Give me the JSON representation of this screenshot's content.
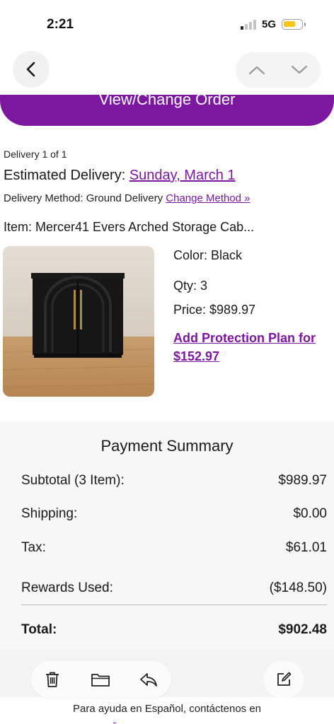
{
  "status": {
    "time": "2:21",
    "network": "5G"
  },
  "order_button": {
    "label": "View/Change Order"
  },
  "delivery": {
    "count": "Delivery 1 of 1",
    "estimated_label": "Estimated Delivery:",
    "estimated_date": "Sunday, March 1",
    "method_label": "Delivery Method: Ground Delivery",
    "change_method": "Change Method »"
  },
  "item": {
    "label": "Item:",
    "name": "Mercer41 Evers Arched Storage Cab...",
    "color_label": "Color:",
    "color": "Black",
    "qty_label": "Qty:",
    "qty": "3",
    "price_label": "Price:",
    "price": "$989.97",
    "protection_line1": "Add Protection Plan for",
    "protection_line2": "$152.97"
  },
  "payment": {
    "title": "Payment Summary",
    "subtotal_label": "Subtotal (3 Item):",
    "subtotal": "$989.97",
    "shipping_label": "Shipping:",
    "shipping": "$0.00",
    "tax_label": "Tax:",
    "tax": "$61.01",
    "rewards_label": "Rewards Used:",
    "rewards": "($148.50)",
    "total_label": "Total:",
    "total": "$902.48"
  },
  "footer": {
    "text": "Para ayuda en Español, contáctenos en"
  },
  "colors": {
    "accent": "#7b189f",
    "battery": "#f5c518"
  },
  "icons": [
    "chevron-left-icon",
    "chevron-up-icon",
    "chevron-down-icon",
    "trash-icon",
    "folder-icon",
    "reply-icon",
    "compose-icon"
  ]
}
